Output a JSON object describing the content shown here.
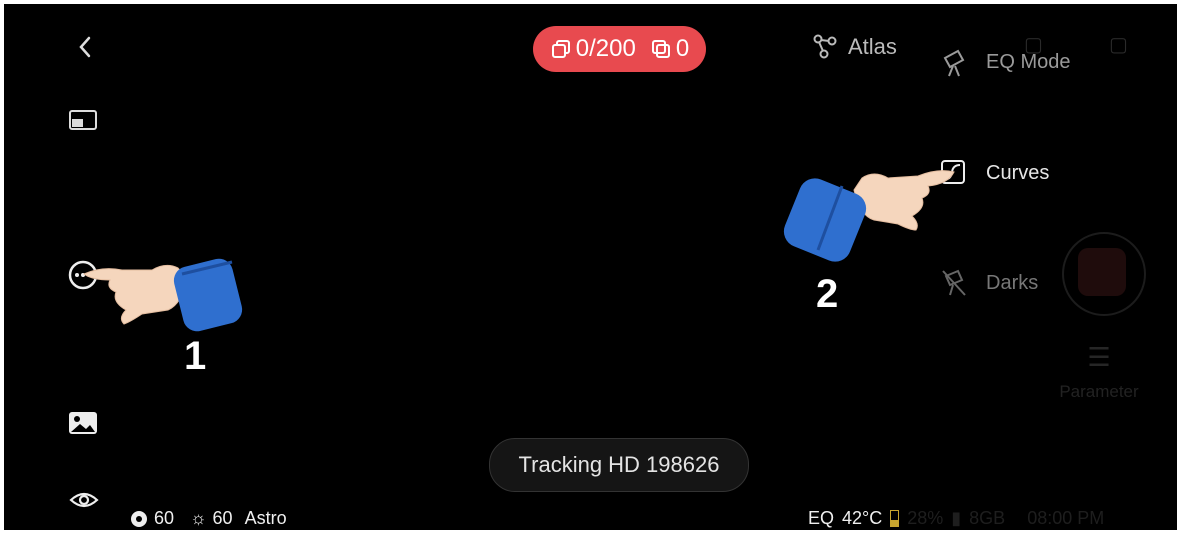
{
  "topbar": {
    "counter_frames": "0/200",
    "counter_stacked": "0",
    "atlas_label": "Atlas"
  },
  "menu": {
    "eq_mode": "EQ Mode",
    "curves": "Curves",
    "darks": "Darks"
  },
  "parameter_label": "Parameter",
  "tracking_label": "Tracking HD 198626",
  "bottom_left": {
    "gain": "60",
    "exposure": "60",
    "mode": "Astro"
  },
  "bottom_right": {
    "mount": "EQ",
    "temperature": "42°C",
    "battery": "28%",
    "storage": "8GB",
    "time": "08:00 PM"
  },
  "annotations": {
    "step1": "1",
    "step2": "2"
  },
  "colors": {
    "background": "#000000",
    "counter_pill": "#e84a4f",
    "hand_sleeve": "#2f6fcf",
    "hand_skin": "#f5d6bd"
  }
}
